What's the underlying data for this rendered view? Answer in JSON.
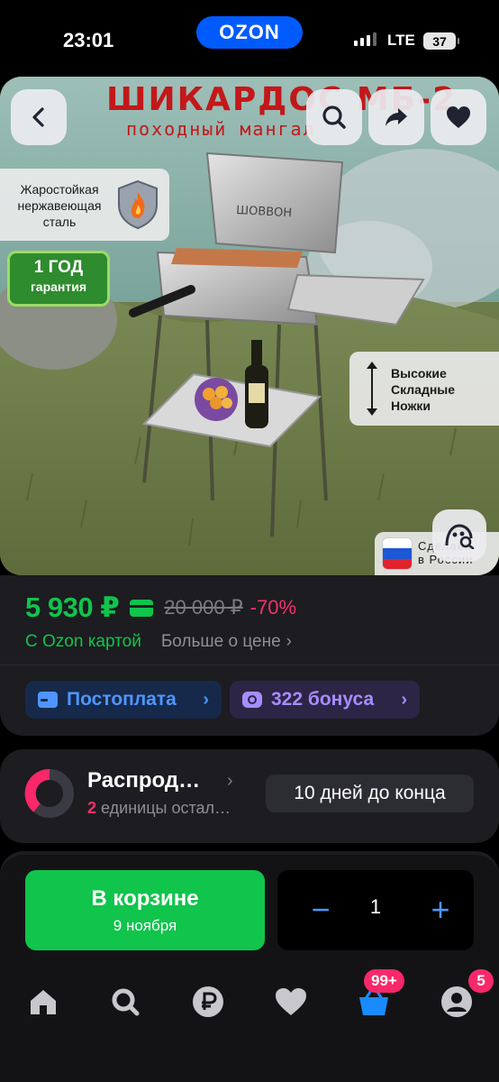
{
  "status_bar": {
    "time": "23:01",
    "app_badge": "OZON",
    "network": "LTE",
    "battery": "37"
  },
  "product_image": {
    "brand_title": "ШИКАРДОС МБ-2",
    "brand_subtitle": "походный мангал",
    "steel_label": "Жаростойкая нержавеющая сталь",
    "warranty_line1": "1 ГОД",
    "warranty_line2": "гарантия",
    "legs_label": [
      "Высокие",
      "Складные",
      "Ножки"
    ],
    "made_in_label": [
      "Сделано",
      "в России"
    ],
    "icons": [
      "back-icon",
      "search-icon",
      "share-icon",
      "heart-icon",
      "visual-search-icon"
    ]
  },
  "price": {
    "current": "5 930 ₽",
    "old": "20 000 ₽",
    "discount": "-70%",
    "ozon_card_label": "С Ozon картой",
    "more_label": "Больше о цене",
    "more_chevron": "›"
  },
  "promos": {
    "postpay_label": "Постоплата",
    "bonus_label": "322 бонуса",
    "chevron": "›"
  },
  "sale": {
    "title": "Распрод…",
    "chevron": "›",
    "units_count": "2",
    "units_text": "единицы остал…",
    "days_left": "10 дней до конца"
  },
  "cart": {
    "button_label": "В корзине",
    "delivery_date": "9 ноября",
    "minus": "−",
    "quantity": "1",
    "plus": "+"
  },
  "tabbar": {
    "tabs": [
      "home",
      "search",
      "finance",
      "favorites",
      "cart",
      "profile"
    ],
    "cart_badge": "99+",
    "profile_badge": "5"
  },
  "colors": {
    "ozon_blue": "#005bff",
    "price_green": "#10c44c",
    "discount_pink": "#f83069",
    "accent_blue": "#4f95ff",
    "bonus_purple": "#a58dff"
  }
}
